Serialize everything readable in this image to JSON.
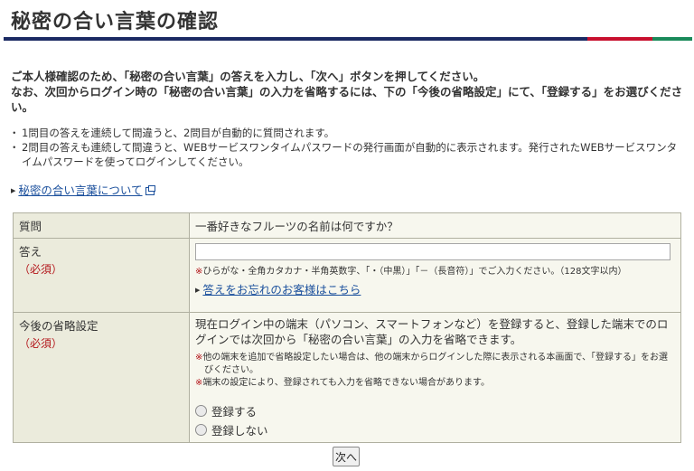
{
  "page": {
    "title": "秘密の合い言葉の確認",
    "intro_line1": "ご本人様確認のため、「秘密の合い言葉」の答えを入力し、「次へ」ボタンを押してください。",
    "intro_line2": "なお、次回からログイン時の「秘密の合い言葉」の入力を省略するには、下の「今後の省略設定」にて、「登録する」をお選びください。",
    "notes": [
      "1問目の答えを連続して間違うと、2問目が自動的に質問されます。",
      "2問目の答えも連続して間違うと、WEBサービスワンタイムパスワードの発行画面が自動的に表示されます。発行されたWEBサービスワンタイムパスワードを使ってログインしてください。"
    ],
    "about_link": "秘密の合い言葉について"
  },
  "form": {
    "question": {
      "label": "質問",
      "text": "一番好きなフルーツの名前は何ですか？"
    },
    "answer": {
      "label": "答え",
      "required": "（必須）",
      "value": "",
      "placeholder": "",
      "note_mark": "※",
      "note": "ひらがな・全角カタカナ・半角英数字、「・（中黒）」「－（長音符）」でご入力ください。（128文字以内）",
      "forgot_link": "答えをお忘れのお客様はこちら"
    },
    "omit": {
      "label": "今後の省略設定",
      "required": "（必須）",
      "description": "現在ログイン中の端末（パソコン、スマートフォンなど）を登録すると、登録した端末でのログインでは次回から「秘密の合い言葉」の入力を省略できます。",
      "note_mark": "※",
      "note1": "他の端末を追加で省略設定したい場合は、他の端末からログインした際に表示される本画面で、「登録する」をお選びください。",
      "note2": "端末の設定により、登録されても入力を省略できない場合があります。",
      "options": [
        "登録する",
        "登録しない"
      ]
    }
  },
  "next_button": "次へ",
  "icons": {
    "link_arrow": "triangle-right-icon",
    "external": "external-link-icon"
  },
  "colors": {
    "accent_navy": "#1b2a63",
    "accent_red": "#c8102e",
    "accent_green": "#1a8a5a",
    "required": "#b3151a",
    "link": "#1a4f9c"
  }
}
